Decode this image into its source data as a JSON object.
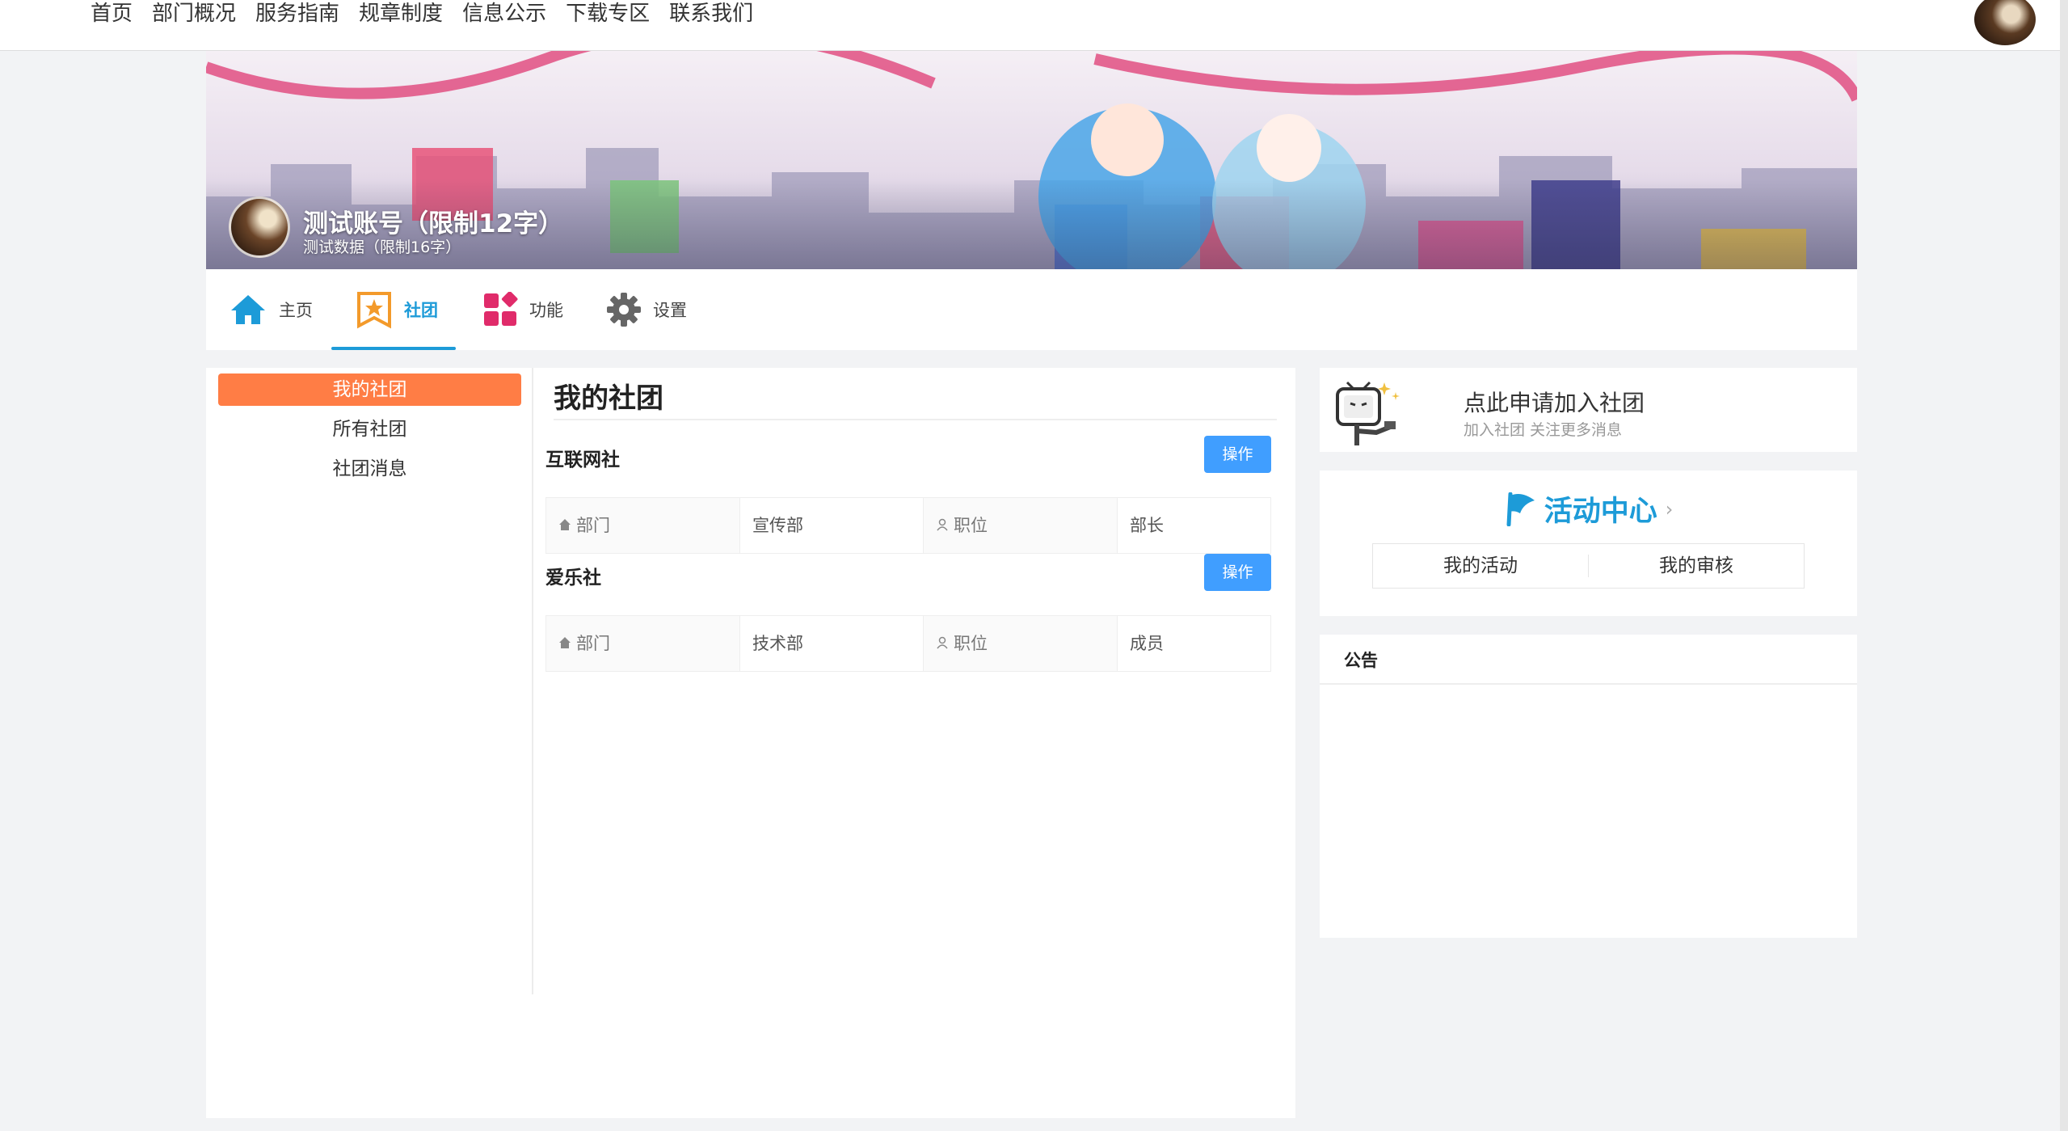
{
  "topnav": {
    "links": [
      "首页",
      "部门概况",
      "服务指南",
      "规章制度",
      "信息公示",
      "下载专区",
      "联系我们"
    ]
  },
  "profile": {
    "name": "测试账号（限制12字）",
    "description": "测试数据（限制16字）"
  },
  "tabs": [
    {
      "label": "主页",
      "icon": "home-icon"
    },
    {
      "label": "社团",
      "icon": "star-badge-icon",
      "active": true
    },
    {
      "label": "功能",
      "icon": "grid-shapes-icon"
    },
    {
      "label": "设置",
      "icon": "gear-icon"
    }
  ],
  "side_menu": {
    "items": [
      "我的社团",
      "所有社团",
      "社团消息"
    ],
    "active_index": 0
  },
  "content": {
    "title": "我的社团",
    "clubs": [
      {
        "name": "互联网社",
        "button": "操作",
        "dept_key": "部门",
        "dept_value": "宣传部",
        "role_key": "职位",
        "role_value": "部长"
      },
      {
        "name": "爱乐社",
        "button": "操作",
        "dept_key": "部门",
        "dept_value": "技术部",
        "role_key": "职位",
        "role_value": "成员"
      }
    ]
  },
  "join": {
    "title": "点此申请加入社团",
    "subtitle": "加入社团 关注更多消息"
  },
  "activity": {
    "title": "活动中心",
    "buttons": [
      "我的活动",
      "我的审核"
    ]
  },
  "notice": {
    "title": "公告"
  },
  "colors": {
    "accent_blue": "#1d9bd8",
    "button_blue": "#409eff",
    "active_orange": "#ff7d45"
  }
}
